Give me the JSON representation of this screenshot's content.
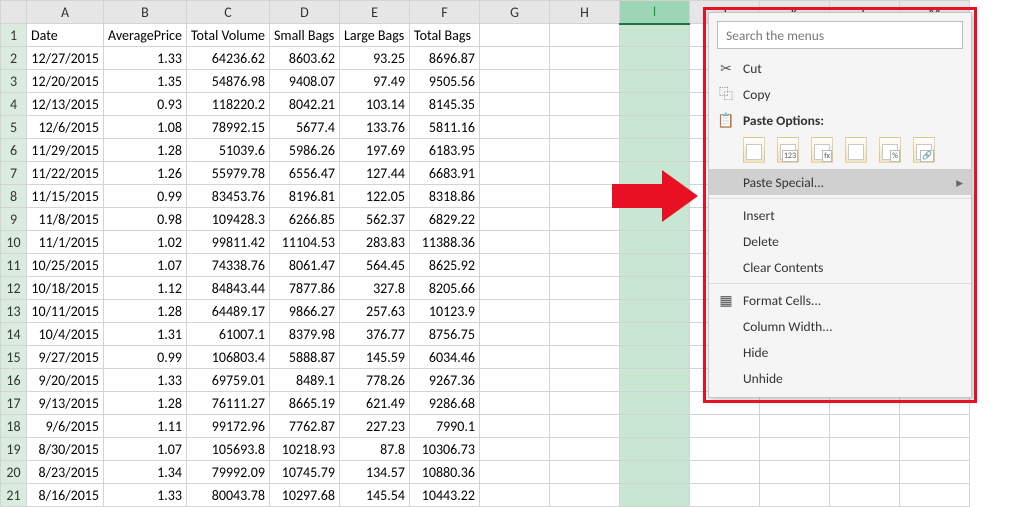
{
  "columns": [
    "A",
    "B",
    "C",
    "D",
    "E",
    "F",
    "G",
    "H",
    "I",
    "J",
    "K",
    "L",
    "M"
  ],
  "headers": {
    "A": "Date",
    "B": "AveragePrice",
    "C": "Total Volume",
    "D": "Small Bags",
    "E": "Large Bags",
    "F": "Total Bags"
  },
  "rows": [
    {
      "r": 1
    },
    {
      "r": 2,
      "A": "12/27/2015",
      "B": "1.33",
      "C": "64236.62",
      "D": "8603.62",
      "E": "93.25",
      "F": "8696.87"
    },
    {
      "r": 3,
      "A": "12/20/2015",
      "B": "1.35",
      "C": "54876.98",
      "D": "9408.07",
      "E": "97.49",
      "F": "9505.56"
    },
    {
      "r": 4,
      "A": "12/13/2015",
      "B": "0.93",
      "C": "118220.2",
      "D": "8042.21",
      "E": "103.14",
      "F": "8145.35"
    },
    {
      "r": 5,
      "A": "12/6/2015",
      "B": "1.08",
      "C": "78992.15",
      "D": "5677.4",
      "E": "133.76",
      "F": "5811.16"
    },
    {
      "r": 6,
      "A": "11/29/2015",
      "B": "1.28",
      "C": "51039.6",
      "D": "5986.26",
      "E": "197.69",
      "F": "6183.95"
    },
    {
      "r": 7,
      "A": "11/22/2015",
      "B": "1.26",
      "C": "55979.78",
      "D": "6556.47",
      "E": "127.44",
      "F": "6683.91"
    },
    {
      "r": 8,
      "A": "11/15/2015",
      "B": "0.99",
      "C": "83453.76",
      "D": "8196.81",
      "E": "122.05",
      "F": "8318.86"
    },
    {
      "r": 9,
      "A": "11/8/2015",
      "B": "0.98",
      "C": "109428.3",
      "D": "6266.85",
      "E": "562.37",
      "F": "6829.22"
    },
    {
      "r": 10,
      "A": "11/1/2015",
      "B": "1.02",
      "C": "99811.42",
      "D": "11104.53",
      "E": "283.83",
      "F": "11388.36"
    },
    {
      "r": 11,
      "A": "10/25/2015",
      "B": "1.07",
      "C": "74338.76",
      "D": "8061.47",
      "E": "564.45",
      "F": "8625.92"
    },
    {
      "r": 12,
      "A": "10/18/2015",
      "B": "1.12",
      "C": "84843.44",
      "D": "7877.86",
      "E": "327.8",
      "F": "8205.66"
    },
    {
      "r": 13,
      "A": "10/11/2015",
      "B": "1.28",
      "C": "64489.17",
      "D": "9866.27",
      "E": "257.63",
      "F": "10123.9"
    },
    {
      "r": 14,
      "A": "10/4/2015",
      "B": "1.31",
      "C": "61007.1",
      "D": "8379.98",
      "E": "376.77",
      "F": "8756.75"
    },
    {
      "r": 15,
      "A": "9/27/2015",
      "B": "0.99",
      "C": "106803.4",
      "D": "5888.87",
      "E": "145.59",
      "F": "6034.46"
    },
    {
      "r": 16,
      "A": "9/20/2015",
      "B": "1.33",
      "C": "69759.01",
      "D": "8489.1",
      "E": "778.26",
      "F": "9267.36"
    },
    {
      "r": 17,
      "A": "9/13/2015",
      "B": "1.28",
      "C": "76111.27",
      "D": "8665.19",
      "E": "621.49",
      "F": "9286.68"
    },
    {
      "r": 18,
      "A": "9/6/2015",
      "B": "1.11",
      "C": "99172.96",
      "D": "7762.87",
      "E": "227.23",
      "F": "7990.1"
    },
    {
      "r": 19,
      "A": "8/30/2015",
      "B": "1.07",
      "C": "105693.8",
      "D": "10218.93",
      "E": "87.8",
      "F": "10306.73"
    },
    {
      "r": 20,
      "A": "8/23/2015",
      "B": "1.34",
      "C": "79992.09",
      "D": "10745.79",
      "E": "134.57",
      "F": "10880.36"
    },
    {
      "r": 21,
      "A": "8/16/2015",
      "B": "1.33",
      "C": "80043.78",
      "D": "10297.68",
      "E": "145.54",
      "F": "10443.22"
    }
  ],
  "selection": {
    "copied_columns": [
      "C",
      "D",
      "E",
      "F"
    ],
    "selected_column": "I"
  },
  "menu": {
    "search_placeholder": "Search the menus",
    "cut": "Cut",
    "copy": "Copy",
    "paste_options": "Paste Options:",
    "paste_icons": [
      "paste",
      "paste-values",
      "paste-formulas",
      "paste-transpose",
      "paste-formatting",
      "paste-link"
    ],
    "paste_icon_tags": [
      "",
      "123",
      "fx",
      "",
      "%",
      "🔗"
    ],
    "paste_special": "Paste Special...",
    "insert": "Insert",
    "delete": "Delete",
    "clear": "Clear Contents",
    "format_cells": "Format Cells...",
    "col_width": "Column Width...",
    "hide": "Hide",
    "unhide": "Unhide"
  }
}
